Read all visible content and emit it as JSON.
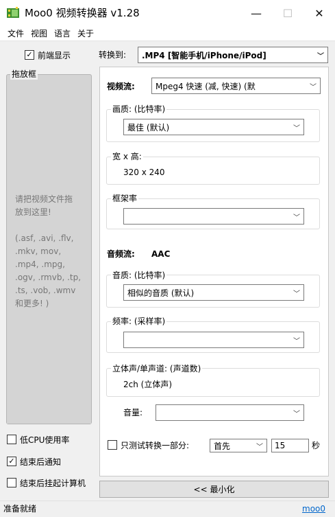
{
  "window": {
    "title": "Moo0 视频转换器 v1.28",
    "min_glyph": "—",
    "max_glyph": "☐",
    "close_glyph": "✕",
    "icon": "film-app-icon"
  },
  "menu": [
    "文件",
    "视图",
    "语言",
    "关于"
  ],
  "left": {
    "always_on_top": {
      "label": "前端显示",
      "checked": true
    },
    "dropbox": {
      "title": "拖放框",
      "text": "请把视频文件拖\n放到这里!\n\n  (.asf, .avi, .flv,\n.mkv, mov,\n.mp4, .mpg,\n.ogv, .rmvb, .tp,\n.ts, .vob, .wmv\n和更多! )"
    },
    "low_cpu": {
      "label": "低CPU使用率",
      "checked": false
    },
    "notify": {
      "label": "结束后通知",
      "checked": true
    },
    "suspend": {
      "label": "结束后挂起计算机",
      "checked": false
    }
  },
  "right": {
    "convert_to_label": "转换到:",
    "format_value": ".MP4   [智能手机/iPhone/iPod]",
    "video": {
      "label": "视频流:",
      "codec_value": "Mpeg4  快速       (减,     快速)   (默",
      "quality": {
        "title": "画质:   (比特率)",
        "value": "最佳 (默认)"
      },
      "size": {
        "title": "宽 x 高:",
        "value": "320 x 240"
      },
      "framerate": {
        "title": "框架率",
        "value": ""
      }
    },
    "audio": {
      "label": "音频流:",
      "codec": "AAC",
      "quality": {
        "title": "音质:   (比特率)",
        "value": "相似的音质  (默认)"
      },
      "frequency": {
        "title": "频率:    (采样率)",
        "value": ""
      },
      "channels": {
        "title": "立体声/单声道:     (声道数)",
        "value": "2ch    (立体声)"
      },
      "volume": {
        "label": "音量:",
        "value": ""
      }
    },
    "partial": {
      "label": "只测试转换一部分:",
      "checked": false,
      "position_value": "首先",
      "seconds_value": "15",
      "unit": "秒"
    },
    "minimize_button": "<< 最小化"
  },
  "status": {
    "text": "准备就绪",
    "link": "moo0"
  }
}
